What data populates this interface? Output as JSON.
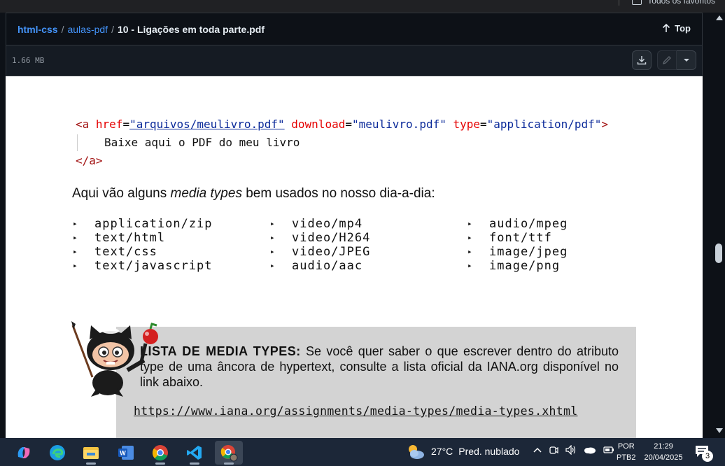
{
  "browser": {
    "favorites_label": "Todos os favoritos"
  },
  "header": {
    "repo": "html-css",
    "folder": "aulas-pdf",
    "file": "10 - Ligações em toda parte.pdf",
    "sep1": "/",
    "sep2": "/",
    "top_label": "Top"
  },
  "subbar": {
    "size": "1.66 MB"
  },
  "pdf": {
    "code": {
      "open_lt": "<a ",
      "attr1": "href",
      "eq1": "=",
      "val1": "\"arquivos/meulivro.pdf\"",
      "attr2": " download",
      "eq2": "=",
      "val2": "\"meulivro.pdf\"",
      "attr3": " type",
      "eq3": "=",
      "val3": "\"application/pdf\"",
      "open_gt": ">",
      "inner": "Baixe aqui o PDF do meu livro",
      "close": "</a>"
    },
    "intro_before": "Aqui vão alguns ",
    "intro_em": "media types",
    "intro_after": " bem usados no nosso dia-a-dia:",
    "bullet": "▸",
    "col1": [
      "application/zip",
      "text/html",
      "text/css",
      "text/javascript"
    ],
    "col2": [
      "video/mp4",
      "video/H264",
      "video/JPEG",
      "audio/aac"
    ],
    "col3": [
      "audio/mpeg",
      "font/ttf",
      "image/jpeg",
      "image/png"
    ],
    "callout_title": "LISTA DE MEDIA TYPES:",
    "callout_text": " Se você quer saber o que escrever dentro do atributo type de uma âncora de hypertext, consulte a lista oficial da IANA.org disponível no link abaixo.",
    "callout_url": "https://www.iana.org/assignments/media-types/media-types.xhtml"
  },
  "taskbar": {
    "apps": [
      "copilot-icon",
      "edge-icon",
      "file-explorer-icon",
      "word-icon",
      "chrome-icon",
      "vscode-icon",
      "chrome-profile-icon"
    ],
    "temp": "27°C",
    "weather": "Pred. nublado",
    "lang1": "POR",
    "lang2": "PTB2",
    "time": "21:29",
    "date": "20/04/2025",
    "notifications": "3"
  },
  "colors": {
    "link": "#4493f8",
    "bg": "#0d1117",
    "taskbar": "#1c2738",
    "callout": "#d3d3d3"
  }
}
